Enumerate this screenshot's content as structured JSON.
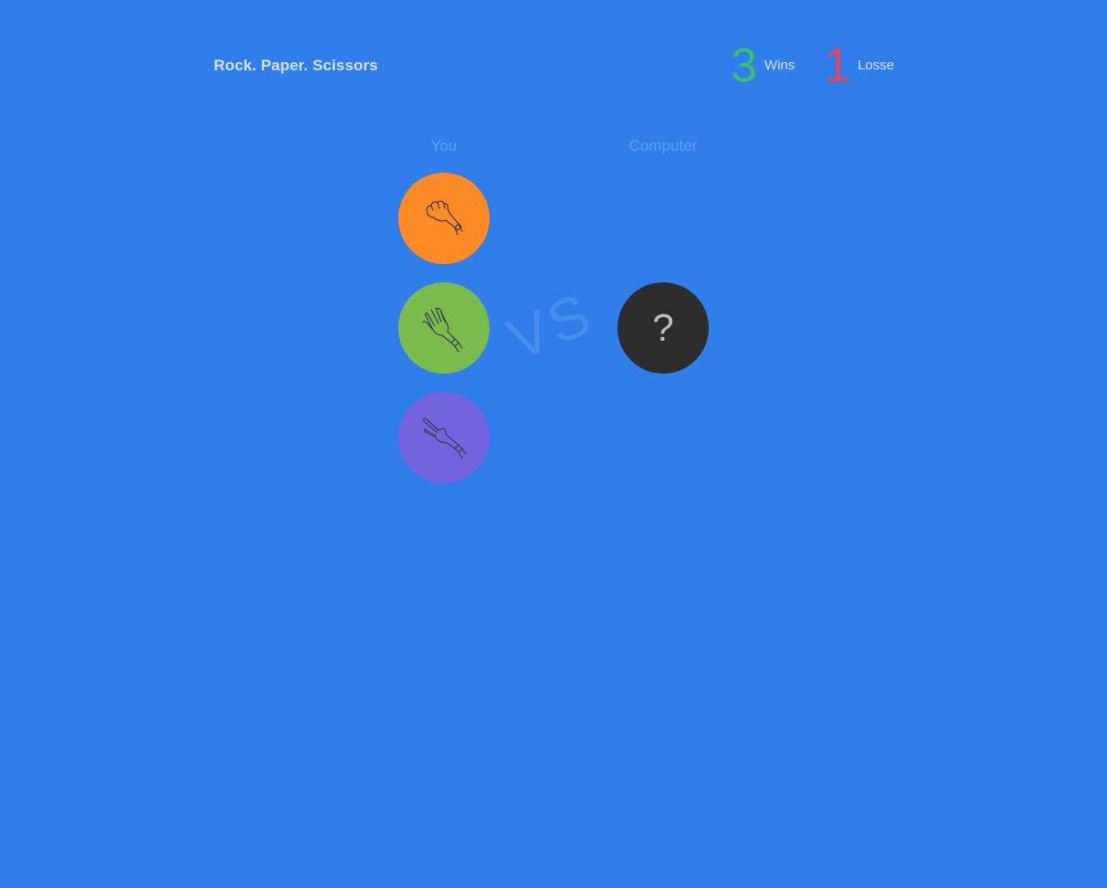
{
  "header": {
    "title": "Rock. Paper. Scissors"
  },
  "score": {
    "wins_count": "3",
    "wins_label": "Wins",
    "losses_count": "1",
    "losses_label": "Losse"
  },
  "columns": {
    "player_label": "You",
    "computer_label": "Computer"
  },
  "choices": [
    {
      "name": "rock",
      "icon": "rock-hand-icon",
      "color": "#fe8a26"
    },
    {
      "name": "paper",
      "icon": "paper-hand-icon",
      "color": "#7abc4c"
    },
    {
      "name": "scissors",
      "icon": "scissors-hand-icon",
      "color": "#7564e0"
    }
  ],
  "vs_text": "VS",
  "computer": {
    "symbol": "?",
    "color": "#2d2d2d"
  },
  "colors": {
    "background": "#2f7eea",
    "wins": "#3ac16b",
    "losses": "#e8445a",
    "icon_stroke": "#3a3a4a"
  }
}
